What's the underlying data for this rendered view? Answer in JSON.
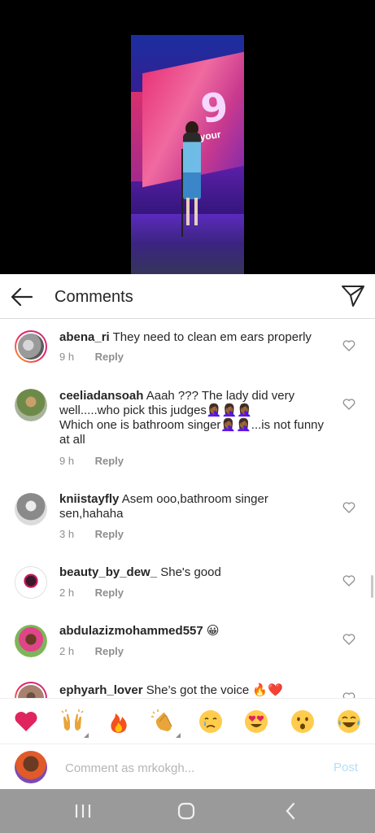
{
  "media": {
    "stage_number": "9",
    "stage_text": "ck your"
  },
  "header": {
    "title": "Comments",
    "back_icon": "arrow-left-icon",
    "share_icon": "paper-plane-icon"
  },
  "comments": [
    {
      "username": "abena_ri",
      "text": "They need to clean em ears properly",
      "time": "9 h",
      "reply": "Reply",
      "story_ring": true
    },
    {
      "username": "ceeliadansoah",
      "text": "Aaah ??? The lady did very well.....who pick this judges🤦🏾‍♀️🤦🏾‍♀️🤦🏾‍♀️\nWhich one is bathroom singer🤦🏾‍♀️🤦🏾‍♀️...is not funny at all",
      "time": "9 h",
      "reply": "Reply",
      "story_ring": false
    },
    {
      "username": "kniistayfly",
      "text": "Asem ooo,bathroom singer sen,hahaha",
      "time": "3 h",
      "reply": "Reply",
      "story_ring": false
    },
    {
      "username": "beauty_by_dew_",
      "text": "She's good",
      "time": "2 h",
      "reply": "Reply",
      "story_ring": false
    },
    {
      "username": "abdulazizmohammed557",
      "text": "😀",
      "time": "2 h",
      "reply": "Reply",
      "story_ring": false
    },
    {
      "username": "ephyarh_lover",
      "text": "She’s got the voice 🔥❤️",
      "time": "",
      "reply": "",
      "story_ring": true
    }
  ],
  "emoji_bar": [
    "❤️",
    "🙌",
    "🔥",
    "👏",
    "😢",
    "😍",
    "😮",
    "😂"
  ],
  "composer": {
    "placeholder": "Comment as mrkokgh...",
    "post_label": "Post"
  },
  "colors": {
    "post_disabled": "#b2dffc",
    "meta_gray": "#8e8e8e",
    "navbar": "#9a9a9a"
  }
}
